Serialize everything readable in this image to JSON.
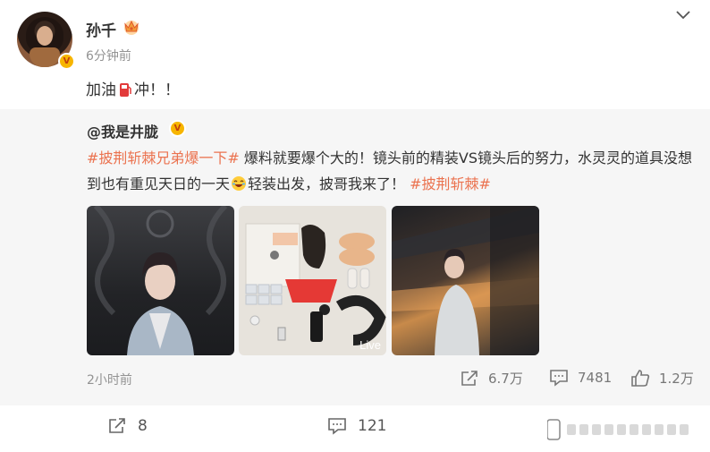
{
  "post": {
    "username": "孙千",
    "time": "6分钟前",
    "text_before": "加油",
    "text_after": "冲！！"
  },
  "repost": {
    "author": "@我是井胧",
    "topic1": "#披荆斩棘兄弟爆一下#",
    "body1": " 爆料就要爆个大的！镜头前的精装VS镜头后的努力，水灵灵的道具没想到也有重见天日的一天",
    "body2": "轻装出发，披哥我来了！",
    "topic2": "#披荆斩棘#",
    "live_label": "Live",
    "time": "2小时前",
    "stats": {
      "reposts": "6.7万",
      "comments": "7481",
      "likes": "1.2万"
    }
  },
  "footer": {
    "reposts": "8",
    "comments": "121"
  },
  "colors": {
    "topic": "#eb7350",
    "badge": "#f7b500",
    "time": "#939393",
    "repost_bg": "#f6f6f6"
  },
  "icons": [
    "crown-icon",
    "chevron-down-icon",
    "fuel-icon",
    "laugh-icon",
    "repost-icon",
    "comment-icon",
    "like-icon",
    "verified-badge-icon"
  ]
}
